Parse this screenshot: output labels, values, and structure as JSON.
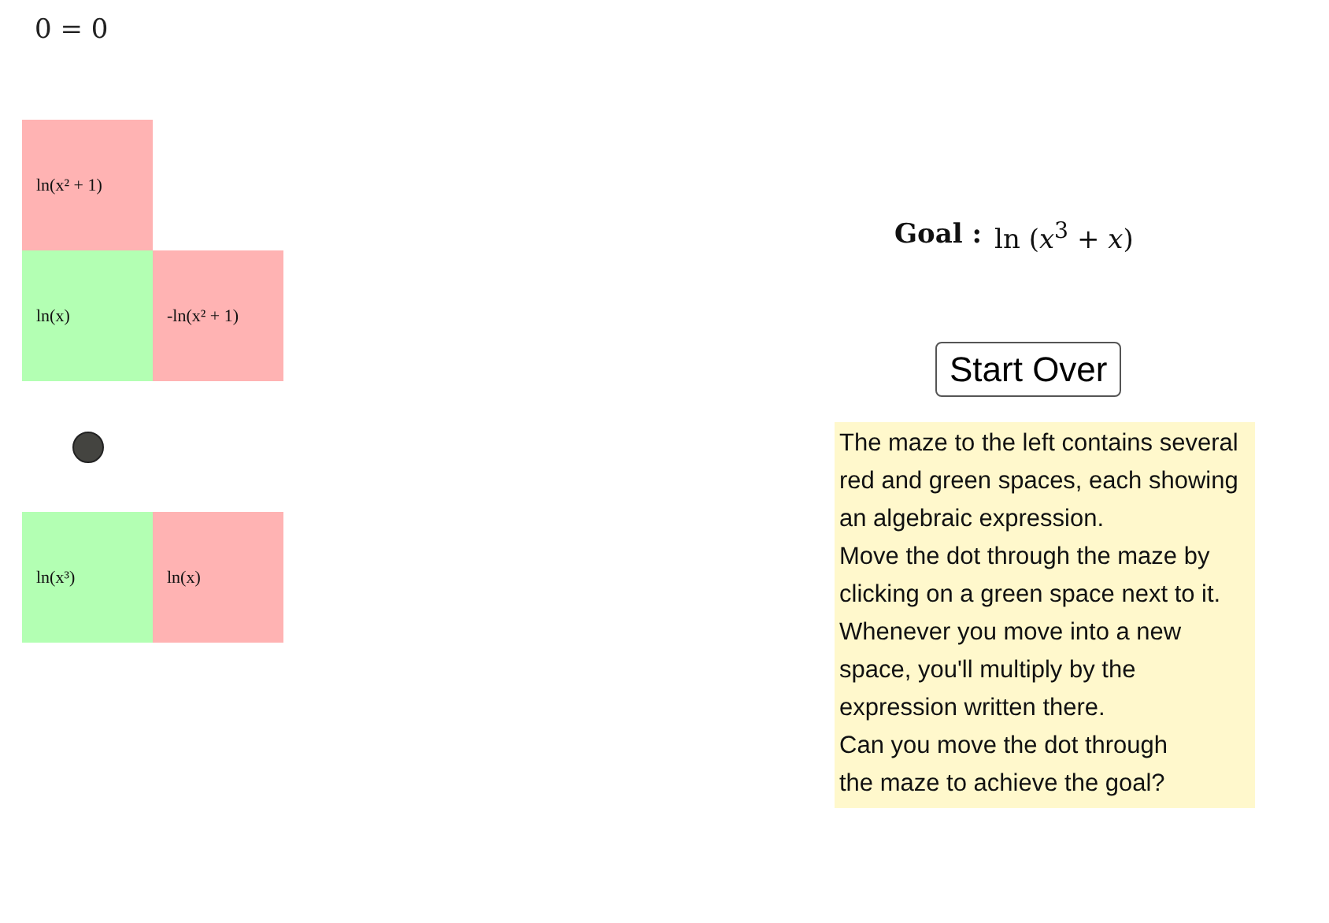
{
  "equation": "0 = 0",
  "maze": [
    [
      {
        "kind": "red",
        "text": "ln(x² + 1)"
      },
      {
        "kind": "empty"
      }
    ],
    [
      {
        "kind": "green",
        "text": "ln(x)"
      },
      {
        "kind": "red",
        "text": "-ln(x² + 1)"
      }
    ],
    [
      {
        "kind": "dot"
      },
      {
        "kind": "empty"
      }
    ],
    [
      {
        "kind": "green",
        "text": "ln(x³)"
      },
      {
        "kind": "red",
        "text": "ln(x)"
      }
    ]
  ],
  "goal": {
    "label": "Goal :",
    "expression": "ln (*x*$^{3}$ + *x*)"
  },
  "start_over_button": "Start Over",
  "instructions": [
    "The maze to the left contains several",
    "red and green spaces, each showing",
    "an algebraic expression.",
    "Move the dot through the maze by",
    "clicking on a green space next to it.",
    "Whenever you move into a new",
    "space, you'll multiply by the",
    "expression written there.",
    "Can you move the dot through",
    "the maze to achieve the goal?"
  ]
}
